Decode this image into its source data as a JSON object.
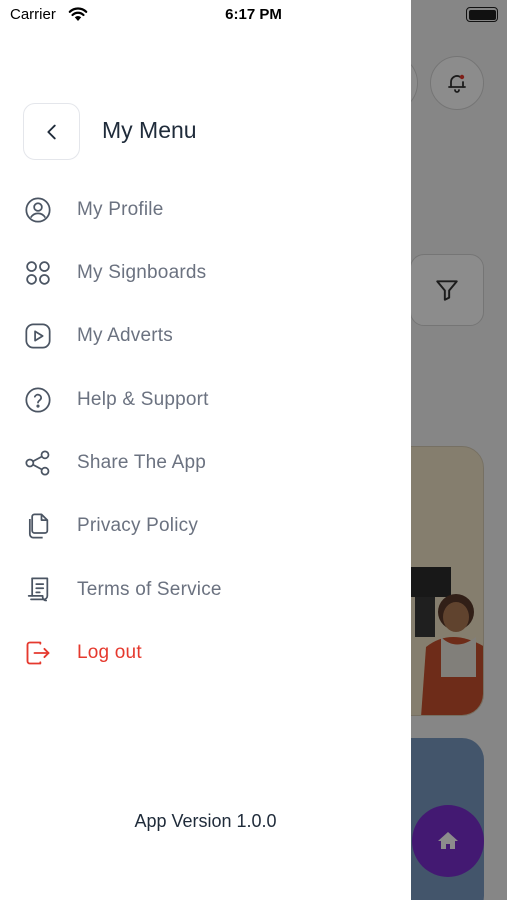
{
  "status_bar": {
    "carrier": "Carrier",
    "time": "6:17 PM"
  },
  "drawer": {
    "title": "My Menu",
    "items": [
      {
        "label": "My Profile",
        "icon": "user-circle-icon"
      },
      {
        "label": "My Signboards",
        "icon": "grid-circles-icon"
      },
      {
        "label": "My Adverts",
        "icon": "play-box-icon"
      },
      {
        "label": "Help & Support",
        "icon": "help-circle-icon"
      },
      {
        "label": "Share The App",
        "icon": "share-icon"
      },
      {
        "label": "Privacy Policy",
        "icon": "documents-icon"
      },
      {
        "label": "Terms of Service",
        "icon": "receipt-icon"
      },
      {
        "label": "Log out",
        "icon": "logout-icon"
      }
    ],
    "app_version": "App Version 1.0.0"
  },
  "colors": {
    "title": "#1f2b3a",
    "item_text": "#6b7280",
    "logout": "#e5392e",
    "home_fab": "#7a2fd0"
  }
}
